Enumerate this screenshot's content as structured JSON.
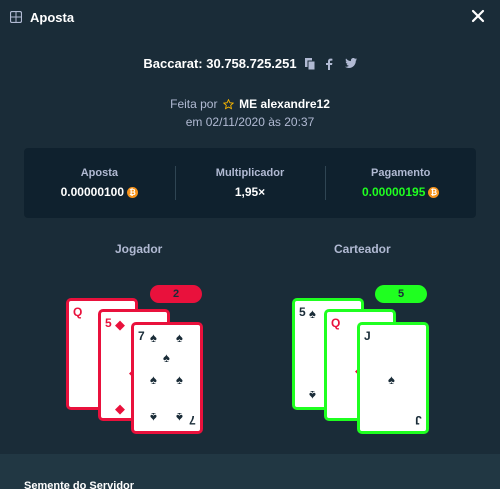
{
  "header": {
    "title": "Aposta"
  },
  "game": {
    "label": "Baccarat: 30.758.725.251"
  },
  "meta": {
    "made_by": "Feita por",
    "user": "ME alexandre12",
    "date": "em 02/11/2020 às 20:37"
  },
  "stats": {
    "bet_label": "Aposta",
    "bet_value": "0.00000100",
    "multiplier_label": "Multiplicador",
    "multiplier_value": "1,95×",
    "payout_label": "Pagamento",
    "payout_value": "0.00000195"
  },
  "player": {
    "title": "Jogador",
    "score": "2",
    "cards": [
      {
        "rank": "Q",
        "suit": "diamond"
      },
      {
        "rank": "5",
        "suit": "diamond"
      },
      {
        "rank": "7",
        "suit": "spade"
      }
    ]
  },
  "banker": {
    "title": "Carteador",
    "score": "5",
    "cards": [
      {
        "rank": "5",
        "suit": "spade"
      },
      {
        "rank": "Q",
        "suit": "diamond"
      },
      {
        "rank": "J",
        "suit": "spade"
      }
    ]
  },
  "footer": {
    "label": "Semente do Servidor"
  },
  "colors": {
    "win": "#1fff20",
    "lose": "#e9113c",
    "coin": "#f7931a"
  },
  "icons": [
    "bet-slip-icon",
    "close-icon",
    "copy-icon",
    "facebook-icon",
    "twitter-icon",
    "star-icon",
    "bitcoin-icon"
  ]
}
